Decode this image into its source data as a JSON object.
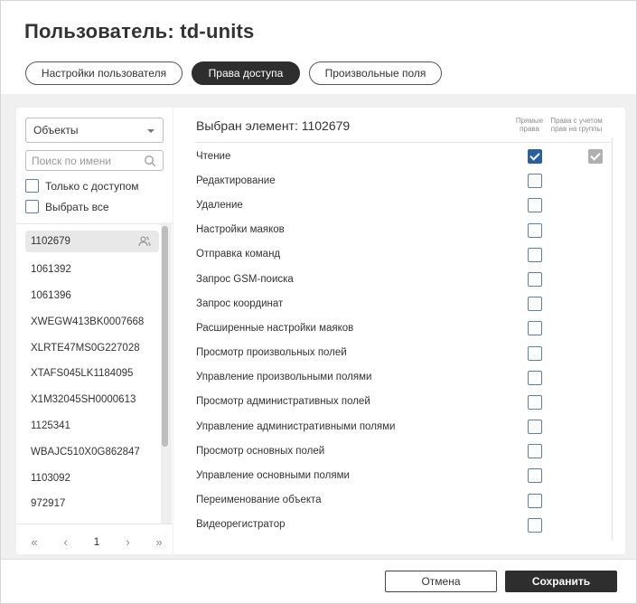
{
  "dialog": {
    "title": "Пользователь: td-units"
  },
  "tabs": [
    {
      "label": "Настройки пользователя",
      "active": false
    },
    {
      "label": "Права доступа",
      "active": true
    },
    {
      "label": "Произвольные поля",
      "active": false
    }
  ],
  "left": {
    "object_type": "Объекты",
    "search_placeholder": "Поиск по имени",
    "only_with_access_label": "Только с доступом",
    "select_all_label": "Выбрать все",
    "objects": [
      "1102679",
      "1061392",
      "1061396",
      "XWEGW413BK0007668",
      "XLRTE47MS0G227028",
      "XTAFS045LK1184095",
      "X1M32045SH0000613",
      "1125341",
      "WBAJC510X0G862847",
      "1103092",
      "972917"
    ],
    "selected_index": 0,
    "pager": {
      "first": "«",
      "prev": "‹",
      "page": "1",
      "next": "›",
      "last": "»"
    }
  },
  "right": {
    "selected_element_label": "Выбран элемент: 1102679",
    "col_direct": "Прямые права",
    "col_with_groups": "Права с учетом прав на группы",
    "permissions": [
      {
        "label": "Чтение",
        "direct": true,
        "with_groups": true
      },
      {
        "label": "Редактирование",
        "direct": false,
        "with_groups": false
      },
      {
        "label": "Удаление",
        "direct": false,
        "with_groups": false
      },
      {
        "label": "Настройки маяков",
        "direct": false,
        "with_groups": false
      },
      {
        "label": "Отправка команд",
        "direct": false,
        "with_groups": false
      },
      {
        "label": "Запрос GSM-поиска",
        "direct": false,
        "with_groups": false
      },
      {
        "label": "Запрос координат",
        "direct": false,
        "with_groups": false
      },
      {
        "label": "Расширенные настройки маяков",
        "direct": false,
        "with_groups": false
      },
      {
        "label": "Просмотр произвольных полей",
        "direct": false,
        "with_groups": false
      },
      {
        "label": "Управление произвольными полями",
        "direct": false,
        "with_groups": false
      },
      {
        "label": "Просмотр административных полей",
        "direct": false,
        "with_groups": false
      },
      {
        "label": "Управление административными полями",
        "direct": false,
        "with_groups": false
      },
      {
        "label": "Просмотр основных полей",
        "direct": false,
        "with_groups": false
      },
      {
        "label": "Управление основными полями",
        "direct": false,
        "with_groups": false
      },
      {
        "label": "Переименование объекта",
        "direct": false,
        "with_groups": false
      },
      {
        "label": "Видеорегистратор",
        "direct": false,
        "with_groups": false
      }
    ]
  },
  "footer": {
    "cancel_label": "Отмена",
    "save_label": "Сохранить"
  },
  "colors": {
    "accent_dark": "#2e2e2e",
    "checkbox_blue": "#2a5fa0",
    "checkbox_border": "#5c7fa6",
    "inherited_gray": "#b0b0b0"
  }
}
